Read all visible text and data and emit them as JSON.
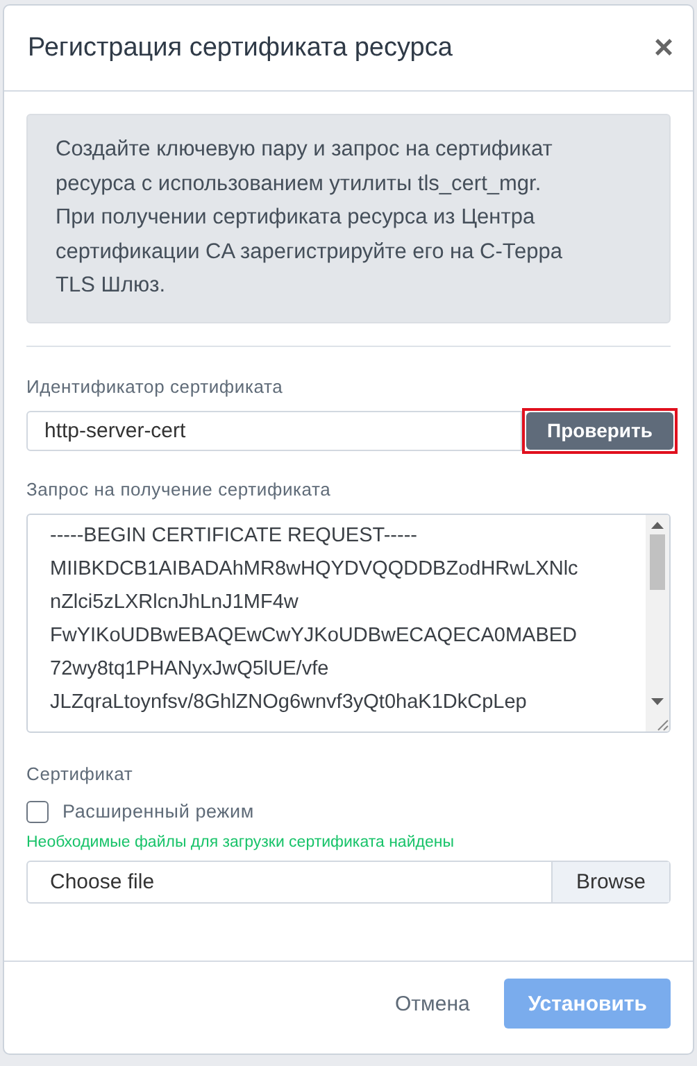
{
  "dialog": {
    "title": "Регистрация сертификата ресурса",
    "close": "×"
  },
  "info": "Создайте ключевую пару и запрос на сертификат ресурса с использованием утилиты tls_cert_mgr. При получении сертификата ресурса из Центра сертификации CA зарегистрируйте его на С-Терра TLS Шлюз.",
  "identifier": {
    "label": "Идентификатор сертификата",
    "value": "http-server-cert",
    "button": {
      "label": "Проверить",
      "highlighted": true
    }
  },
  "request": {
    "label": "Запрос на получение сертификата",
    "lines": [
      "-----BEGIN CERTIFICATE REQUEST-----",
      "MIIBKDCB1AIBADAhMR8wHQYDVQQDDBZodHRwLXNlc",
      "nZlci5zLXRlcnJhLnJ1MF4w",
      "FwYIKoUDBwEBAQEwCwYJKoUDBwECAQECA0MABED",
      "72wy8tq1PHANyxJwQ5lUE/vfe",
      "JLZqraLtoynfsv/8GhlZNOg6wnvf3yQt0haK1DkCpLep"
    ]
  },
  "certificate": {
    "label": "Сертификат",
    "advanced": {
      "label": "Расширенный режим",
      "checked": false
    },
    "status": "Необходимые файлы для загрузки сертификата найдены",
    "file_placeholder": "Choose file",
    "browse": "Browse"
  },
  "footer": {
    "cancel": "Отмена",
    "submit": {
      "label": "Установить",
      "disabled": true
    }
  }
}
